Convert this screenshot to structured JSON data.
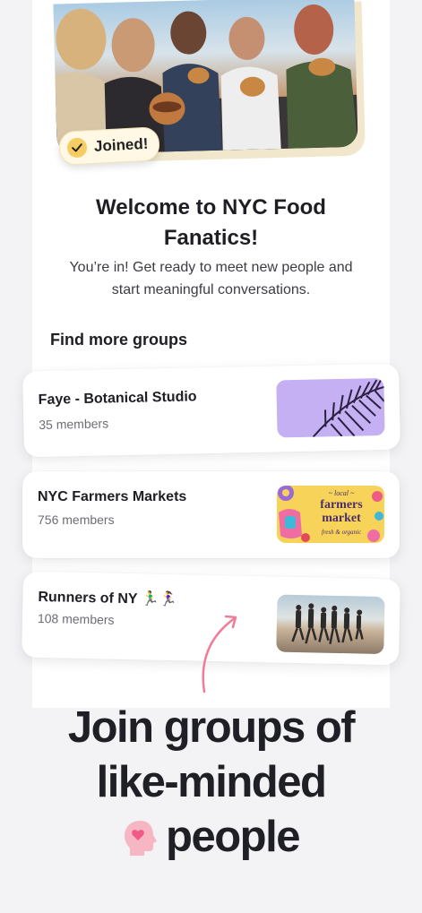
{
  "hero": {
    "badge_label": "Joined!",
    "title": "Welcome to NYC Food Fanatics!",
    "subtitle": "You’re in! Get ready to meet new people and start meaningful conversations."
  },
  "groups": {
    "heading": "Find more groups",
    "items": [
      {
        "name": "Faye - Botanical Studio",
        "members": "35 members"
      },
      {
        "name": "NYC Farmers Markets",
        "members": "756 members",
        "thumb_text": {
          "top": "~ local ~",
          "line1": "farmers",
          "line2": "market",
          "bottom": "fresh & organic"
        }
      },
      {
        "name": "Runners of NY 🏃‍♂️🏃‍♀️",
        "members": "108 members"
      }
    ]
  },
  "tagline": {
    "line1": "Join groups of",
    "line2": "like-minded",
    "line3": "people"
  },
  "colors": {
    "accent_pink": "#ef7d98",
    "badge_yellow": "#f6cd62",
    "botanical_purple": "#c4b0f2",
    "farmers_yellow": "#f8d35a"
  }
}
